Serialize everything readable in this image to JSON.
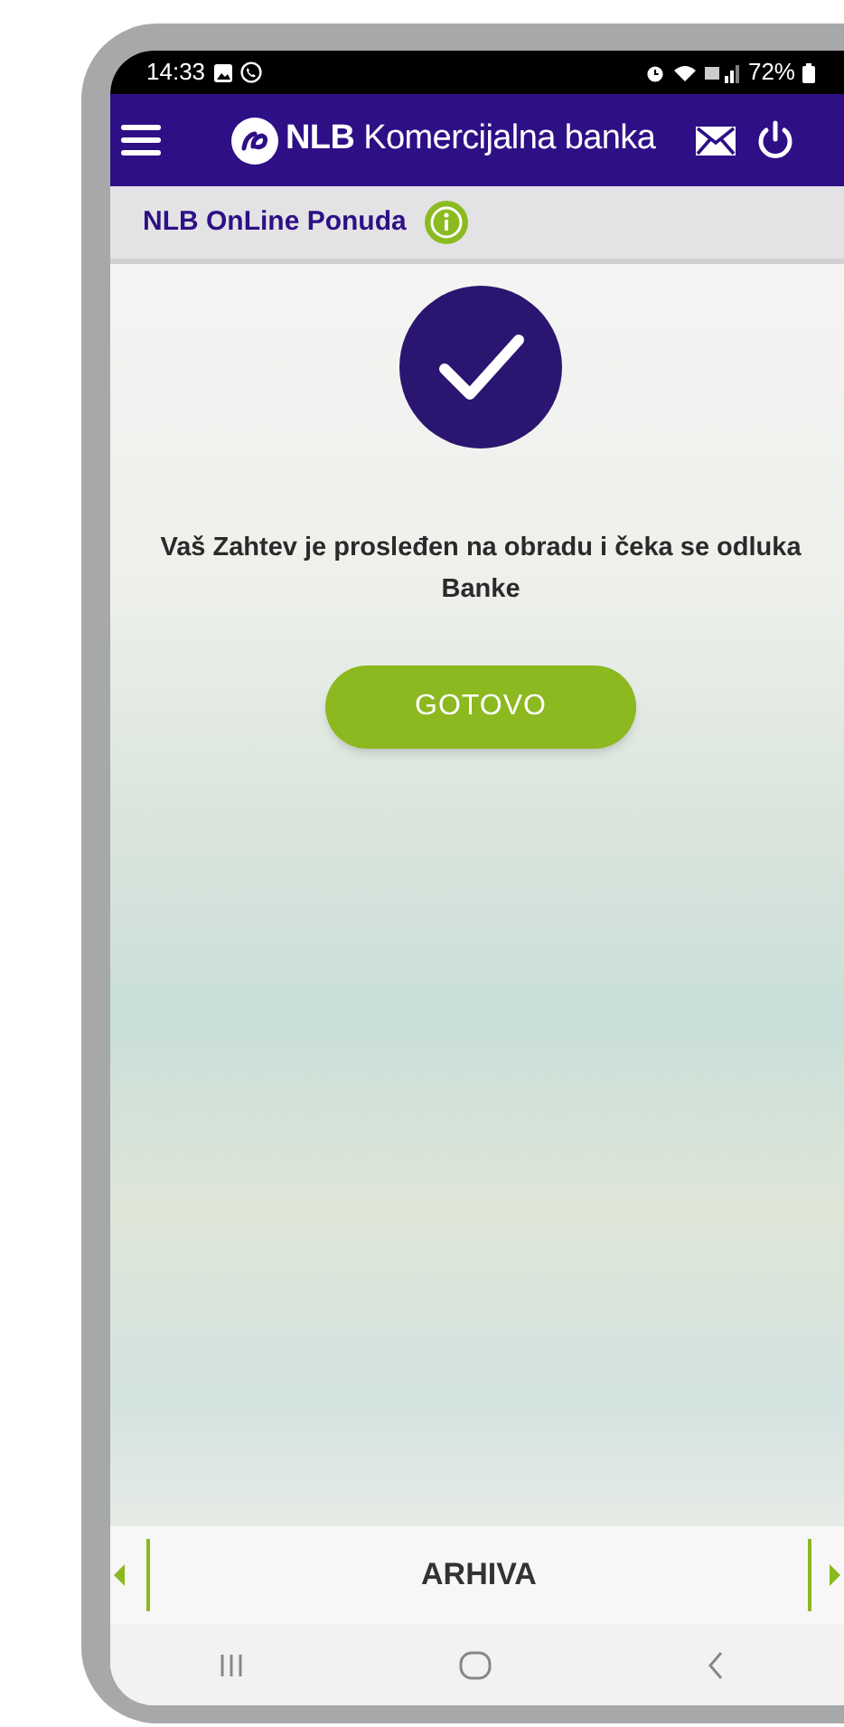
{
  "status_bar": {
    "time": "14:33",
    "battery": "72%"
  },
  "header": {
    "brand": "**NLB** Komercijalna banka"
  },
  "subheader": {
    "title": "NLB OnLine Ponuda"
  },
  "message": "Vaš Zahtev je prosleđen na obradu i čeka se odluka Banke",
  "button": "GOTOVO",
  "bottom_bar": {
    "label": "ARHIVA"
  }
}
